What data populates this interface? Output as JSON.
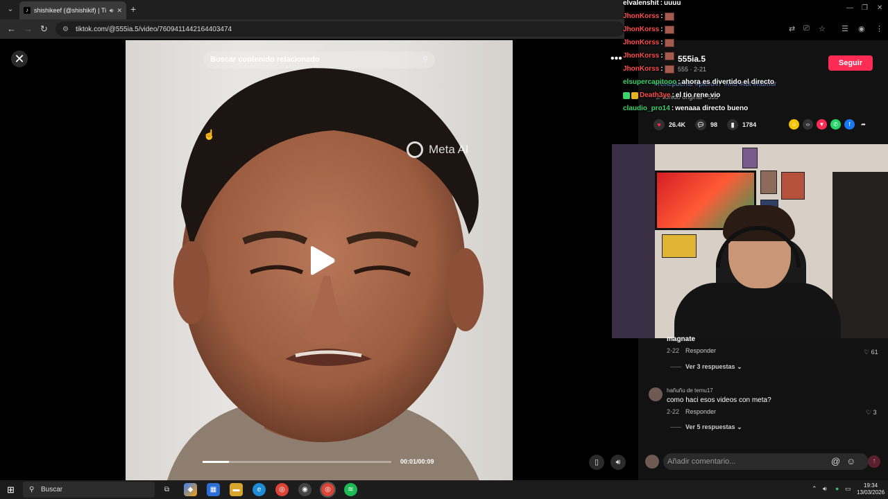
{
  "browser": {
    "tab_title": "shishikeef (@shishikif) | Tik",
    "url": "tiktok.com/@555ia.5/video/7609411442164403474"
  },
  "video": {
    "search_placeholder": "Buscar contenido relacionado",
    "watermark": "Meta AI",
    "time": "00:01/00:09",
    "progress": 0.14
  },
  "profile": {
    "name": "555ia.5",
    "meta": "555 · 2-21",
    "follow_label": "Seguir",
    "hashtags": "#renepuente #piero47 #m5 #tbt #humor",
    "sound": "♫ sonido original - 555"
  },
  "stats": {
    "likes": "26.4K",
    "comments": "98",
    "saves": "1784"
  },
  "stream_chat": [
    {
      "user": "elvalenshit",
      "color": "#ffffff",
      "message": "uuuu"
    },
    {
      "user": "JhonKorss",
      "color": "#ff4b4b",
      "message": "",
      "emote": true
    },
    {
      "user": "JhonKorss",
      "color": "#ff4b4b",
      "message": "",
      "emote": true
    },
    {
      "user": "JhonKorss",
      "color": "#ff4b4b",
      "message": "",
      "emote": true
    },
    {
      "user": "JhonKorss",
      "color": "#ff4b4b",
      "message": "",
      "emote": true
    },
    {
      "user": "JhonKorss",
      "color": "#ff4b4b",
      "message": "",
      "emote": true
    },
    {
      "user": "elsupercapitooo",
      "color": "#3cd36b",
      "message": "ahora es divertido el directo"
    },
    {
      "user": "Death3ye",
      "color": "#ff4b4b",
      "message": "el tio rene vio",
      "badges": true
    },
    {
      "user": "claudio_pro14",
      "color": "#3cd36b",
      "message": "wenaaa directo bueno"
    }
  ],
  "comments": {
    "first": {
      "text": "magnate",
      "date": "2-22",
      "reply": "Responder",
      "likes": "61",
      "view_replies": "Ver 3 respuestas"
    },
    "second": {
      "user": "hañuñu de temu17",
      "text": "como haci esos videos con meta?",
      "date": "2-22",
      "reply": "Responder",
      "likes": "3",
      "view_replies": "Ver 5 respuestas"
    },
    "input_placeholder": "Añadir comentario..."
  },
  "taskbar": {
    "search_label": "Buscar",
    "time": "19:34",
    "date": "13/03/2026"
  }
}
